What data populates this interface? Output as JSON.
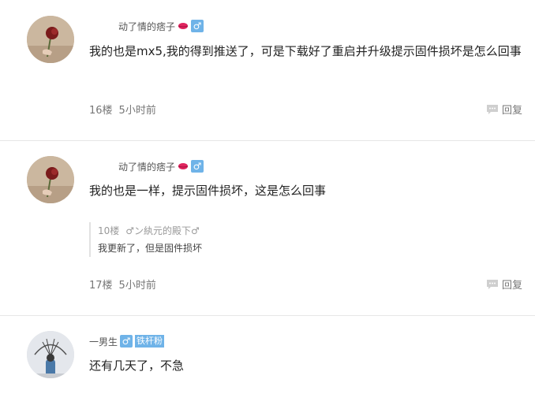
{
  "posts": [
    {
      "username": "动了情的痞子",
      "gender": "♂",
      "content": "我的也是mx5,我的得到推送了，可是下载好了重启并升级提示固件损坏是怎么回事",
      "floor": "16楼",
      "time": "5小时前",
      "reply_label": "回复"
    },
    {
      "username": "动了情的痞子",
      "gender": "♂",
      "content": "我的也是一样，提示固件损坏，这是怎么回事",
      "quote": {
        "floor": "10楼",
        "user": "♂ン紈元的殿下♂",
        "text": "我更新了，但是固件损坏"
      },
      "floor": "17楼",
      "time": "5小时前",
      "reply_label": "回复"
    },
    {
      "username": "一男生",
      "gender": "♂",
      "badge": "铁杆粉",
      "content": "还有几天了，不急"
    }
  ],
  "icons": {
    "lips": "lips-icon",
    "reply": "comment-bubble-icon"
  },
  "colors": {
    "gender_badge": "#6fb3e8",
    "divider": "#e6e6e6"
  }
}
